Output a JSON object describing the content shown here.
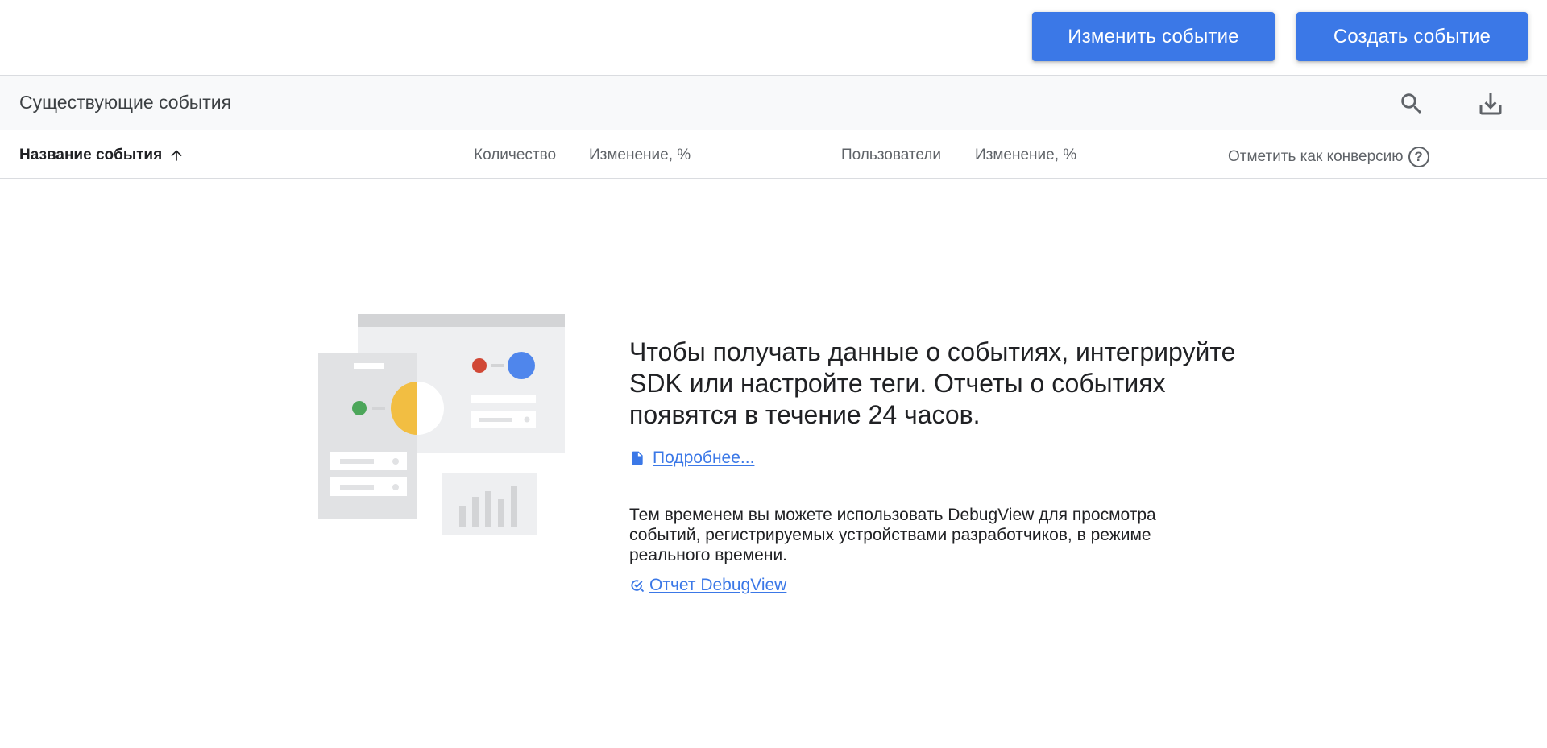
{
  "toolbar": {
    "edit_event_label": "Изменить событие",
    "create_event_label": "Создать событие"
  },
  "section": {
    "title": "Существующие события"
  },
  "table": {
    "columns": {
      "name": "Название события",
      "count": "Количество",
      "count_change": "Изменение, %",
      "users": "Пользователи",
      "users_change": "Изменение, %",
      "mark_conversion": "Отметить как конверсию"
    },
    "help_glyph": "?"
  },
  "empty_state": {
    "headline": "Чтобы получать данные о событиях, интегрируйте SDK или настройте теги. Отчеты о событиях появятся в течение 24 часов.",
    "learn_more_link": "Подробнее...",
    "description": "Тем временем вы можете использовать DebugView для просмотра событий, регистрируемых устройствами разработчиков, в режиме реального времени.",
    "debugview_link": "Отчет DebugView"
  },
  "icons": {
    "search": "search-icon",
    "download": "download-icon",
    "sort": "arrow-up-icon",
    "document": "document-icon",
    "debug": "debug-check-icon",
    "help": "help-icon"
  },
  "colors": {
    "primary": "#3b78e7",
    "illustration_red": "#d14836",
    "illustration_blue": "#4f86ec",
    "illustration_green": "#4ca65a",
    "illustration_yellow": "#f2be42"
  }
}
